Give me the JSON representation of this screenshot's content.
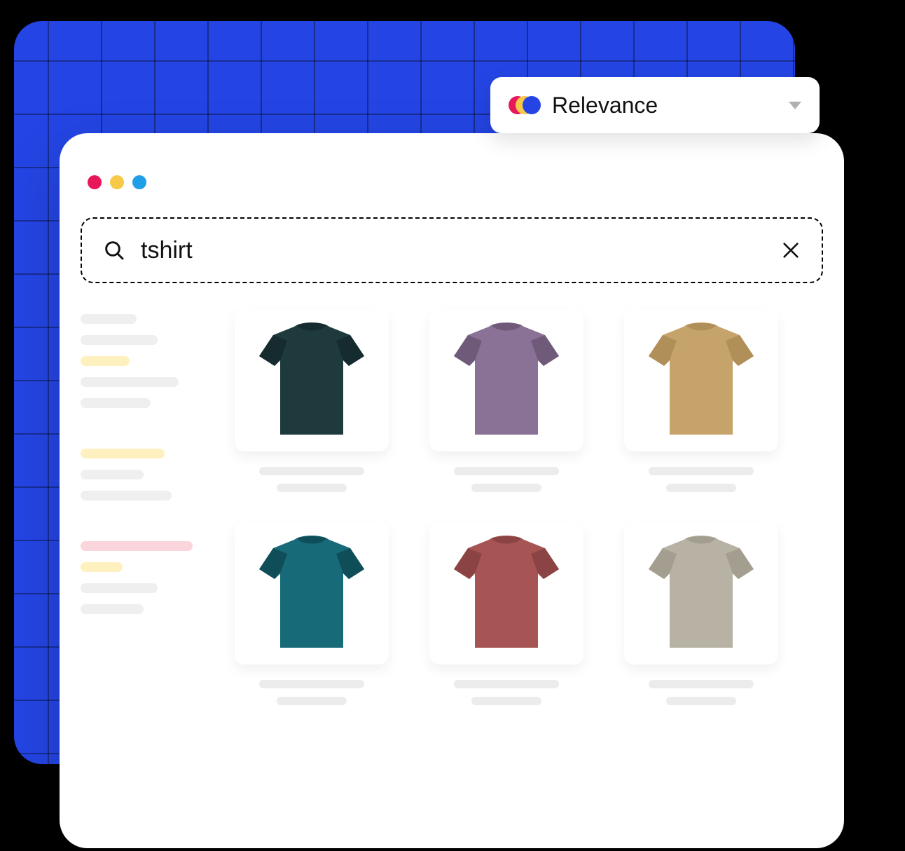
{
  "sort": {
    "label": "Relevance"
  },
  "search": {
    "value": "tshirt"
  },
  "sidebar": {
    "blocks": [
      [
        "grey-80",
        "grey-110",
        "yellow-70",
        "grey-140",
        "grey-100"
      ],
      [
        "yellow-120",
        "grey-90",
        "grey-130"
      ],
      [
        "pink-160",
        "yellow-60",
        "grey-110",
        "grey-90"
      ]
    ]
  },
  "products": [
    {
      "color_body": "#1F3A3D",
      "color_sleeve": "#162B2E",
      "name": "tshirt-dark-teal"
    },
    {
      "color_body": "#8A7196",
      "color_sleeve": "#6F5A7A",
      "name": "tshirt-purple"
    },
    {
      "color_body": "#C6A36B",
      "color_sleeve": "#B18F59",
      "name": "tshirt-tan"
    },
    {
      "color_body": "#176A78",
      "color_sleeve": "#0F4E59",
      "name": "tshirt-ocean-teal"
    },
    {
      "color_body": "#A65454",
      "color_sleeve": "#8C4343",
      "name": "tshirt-maroon"
    },
    {
      "color_body": "#B7B2A3",
      "color_sleeve": "#A39E8F",
      "name": "tshirt-stone"
    }
  ]
}
